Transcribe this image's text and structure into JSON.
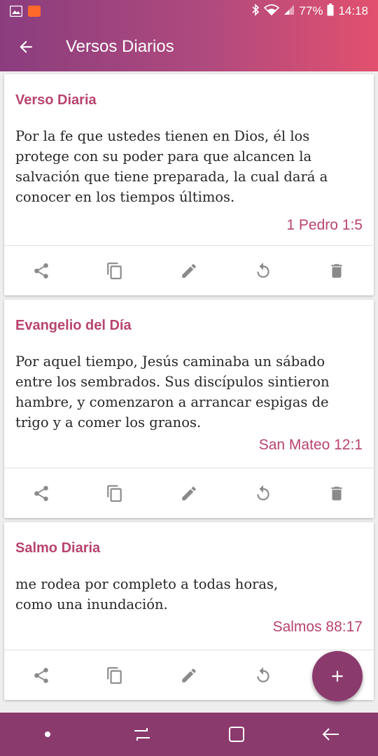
{
  "status_bar": {
    "battery": "77%",
    "time": "14:18"
  },
  "app_bar": {
    "title": "Versos Diarios"
  },
  "cards": [
    {
      "title": "Verso Diaria",
      "text": "Por la fe que ustedes tienen en Dios, él los\nprotege con su poder para que alcancen la\nsalvación que tiene preparada, la cual dará a\nconocer en los tiempos últimos.",
      "reference": "1 Pedro 1:5"
    },
    {
      "title": "Evangelio del Día",
      "text": "Por aquel tiempo, Jesús caminaba un sábado\nentre los sembrados. Sus discípulos sintieron\nhambre, y comenzaron a arrancar espigas de\ntrigo y a comer los granos.",
      "reference": "San Mateo 12:1"
    },
    {
      "title": "Salmo Diaria",
      "text": "me rodea por completo a todas horas,\ncomo una inundación.",
      "reference": "Salmos 88:17"
    }
  ],
  "actions": [
    "share-icon",
    "copy-icon",
    "edit-icon",
    "refresh-icon",
    "delete-icon"
  ],
  "fab": {
    "icon": "plus-icon"
  },
  "colors": {
    "accent": "#b8436f",
    "fab": "#8b3a6e",
    "gradient_start": "#8a3d7e",
    "gradient_end": "#e2506e"
  }
}
